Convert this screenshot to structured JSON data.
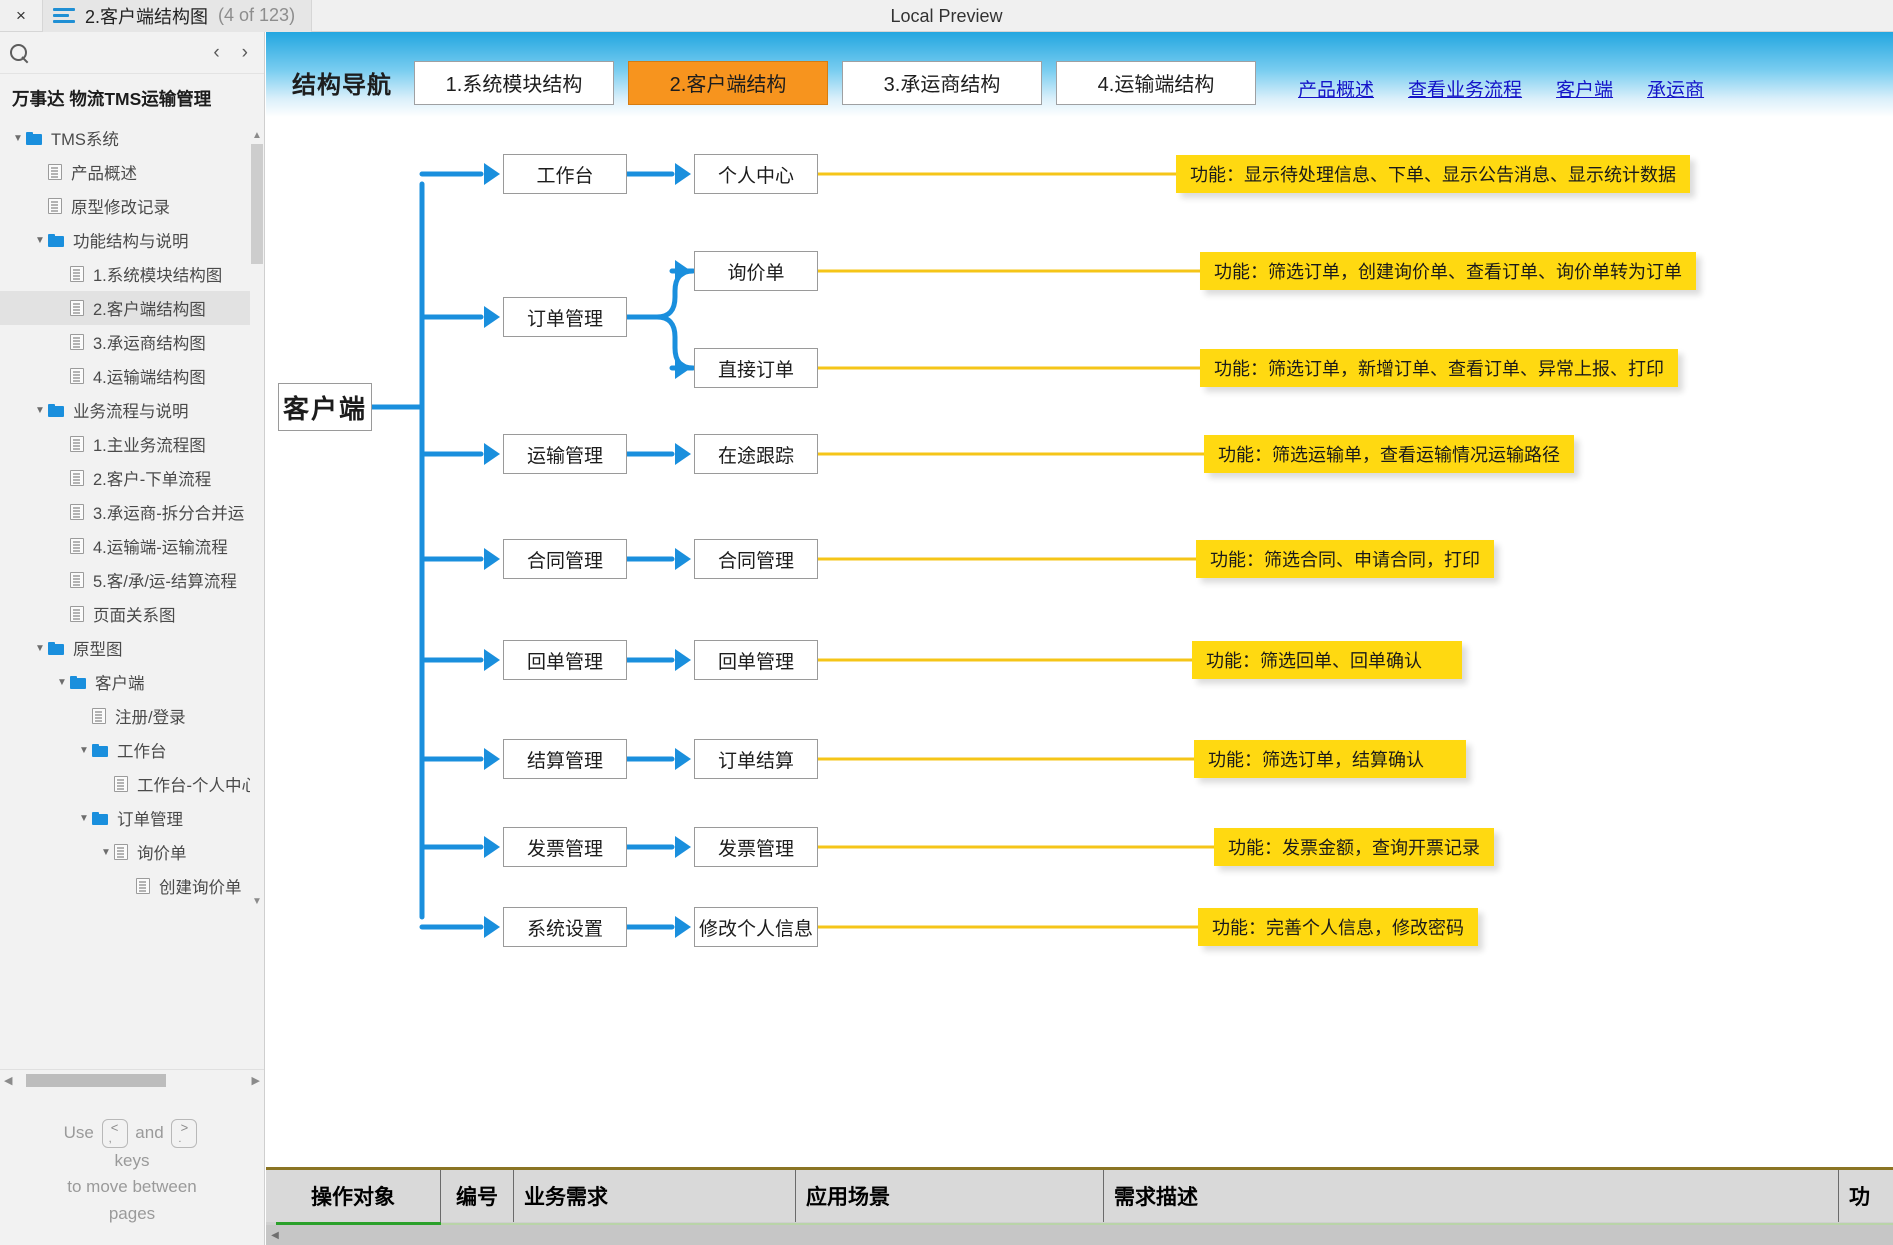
{
  "window": {
    "close_label": "×",
    "menu_icon": "hamburger-icon",
    "tab_title": "2.客户端结构图",
    "tab_count": "(4 of 123)",
    "center_title": "Local Preview"
  },
  "sidebar": {
    "search_icon": "search-icon",
    "prev_icon": "‹",
    "next_icon": "›",
    "project_title": "万事达 物流TMS运输管理",
    "tree": [
      {
        "label": "TMS系统",
        "depth": 0,
        "type": "folder",
        "caret": "▼",
        "selected": false
      },
      {
        "label": "产品概述",
        "depth": 1,
        "type": "page",
        "caret": "",
        "selected": false
      },
      {
        "label": "原型修改记录",
        "depth": 1,
        "type": "page",
        "caret": "",
        "selected": false
      },
      {
        "label": "功能结构与说明",
        "depth": 1,
        "type": "folder",
        "caret": "▼",
        "selected": false
      },
      {
        "label": "1.系统模块结构图",
        "depth": 2,
        "type": "page",
        "caret": "",
        "selected": false
      },
      {
        "label": "2.客户端结构图",
        "depth": 2,
        "type": "page",
        "caret": "",
        "selected": true
      },
      {
        "label": "3.承运商结构图",
        "depth": 2,
        "type": "page",
        "caret": "",
        "selected": false
      },
      {
        "label": "4.运输端结构图",
        "depth": 2,
        "type": "page",
        "caret": "",
        "selected": false
      },
      {
        "label": "业务流程与说明",
        "depth": 1,
        "type": "folder",
        "caret": "▼",
        "selected": false
      },
      {
        "label": "1.主业务流程图",
        "depth": 2,
        "type": "page",
        "caret": "",
        "selected": false
      },
      {
        "label": "2.客户-下单流程",
        "depth": 2,
        "type": "page",
        "caret": "",
        "selected": false
      },
      {
        "label": "3.承运商-拆分合并运",
        "depth": 2,
        "type": "page",
        "caret": "",
        "selected": false
      },
      {
        "label": "4.运输端-运输流程",
        "depth": 2,
        "type": "page",
        "caret": "",
        "selected": false
      },
      {
        "label": "5.客/承/运-结算流程",
        "depth": 2,
        "type": "page",
        "caret": "",
        "selected": false
      },
      {
        "label": "页面关系图",
        "depth": 2,
        "type": "page",
        "caret": "",
        "selected": false
      },
      {
        "label": "原型图",
        "depth": 1,
        "type": "folder",
        "caret": "▼",
        "selected": false
      },
      {
        "label": "客户端",
        "depth": 2,
        "type": "folder",
        "caret": "▼",
        "selected": false
      },
      {
        "label": "注册/登录",
        "depth": 3,
        "type": "page",
        "caret": "",
        "selected": false
      },
      {
        "label": "工作台",
        "depth": 3,
        "type": "folder",
        "caret": "▼",
        "selected": false
      },
      {
        "label": "工作台-个人中心",
        "depth": 4,
        "type": "page",
        "caret": "",
        "selected": false
      },
      {
        "label": "订单管理",
        "depth": 3,
        "type": "folder",
        "caret": "▼",
        "selected": false
      },
      {
        "label": "询价单",
        "depth": 4,
        "type": "page",
        "caret": "▼",
        "selected": false
      },
      {
        "label": "创建询价单",
        "depth": 5,
        "type": "page",
        "caret": "",
        "selected": false
      }
    ],
    "hint": {
      "use": "Use",
      "and": "and",
      "key_prev_top": "<",
      "key_prev_bot": ",",
      "key_next_top": ">",
      "key_next_bot": ".",
      "line2": "keys",
      "line3": "to move between",
      "line4": "pages"
    }
  },
  "nav": {
    "title": "结构导航",
    "tabs": [
      {
        "label": "1.系统模块结构",
        "active": false
      },
      {
        "label": "2.客户端结构",
        "active": true
      },
      {
        "label": "3.承运商结构",
        "active": false
      },
      {
        "label": "4.运输端结构",
        "active": false
      }
    ],
    "links": [
      "产品概述",
      "查看业务流程",
      "客户端",
      "承运商"
    ]
  },
  "diagram": {
    "root": "客户端",
    "rows": [
      {
        "module": "工作台",
        "page": "个人中心",
        "note": "功能：显示待处理信息、下单、显示公告消息、显示统计数据"
      },
      {
        "module": "订单管理",
        "page": "询价单",
        "note": "功能：筛选订单，创建询价单、查看订单、询价单转为订单"
      },
      {
        "module": "",
        "page": "直接订单",
        "note": "功能：筛选订单，新增订单、查看订单、异常上报、打印"
      },
      {
        "module": "运输管理",
        "page": "在途跟踪",
        "note": "功能：筛选运输单，查看运输情况运输路径"
      },
      {
        "module": "合同管理",
        "page": "合同管理",
        "note": "功能：筛选合同、申请合同，打印"
      },
      {
        "module": "回单管理",
        "page": "回单管理",
        "note": "功能：筛选回单、回单确认"
      },
      {
        "module": "结算管理",
        "page": "订单结算",
        "note": "功能：筛选订单，结算确认"
      },
      {
        "module": "发票管理",
        "page": "发票管理",
        "note": "功能：发票金额，查询开票记录"
      },
      {
        "module": "系统设置",
        "page": "修改个人信息",
        "note": "功能：完善个人信息，修改密码"
      }
    ]
  },
  "bottom_table": {
    "headers": [
      "操作对象",
      "编号",
      "业务需求",
      "应用场景",
      "需求描述",
      "功"
    ]
  },
  "colors": {
    "accent_blue": "#1a8fdd",
    "tab_orange": "#f7941e",
    "callout_yellow": "#ffd911",
    "link_blue": "#1414c8"
  }
}
